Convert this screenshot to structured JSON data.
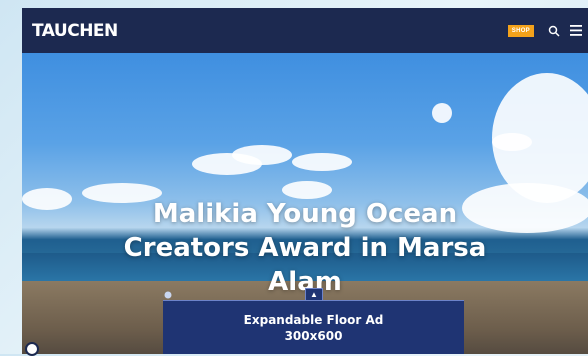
{
  "header": {
    "logo": "TAUCHEN",
    "shop_label": "SHOP",
    "search_icon": "search-icon",
    "menu_icon": "menu-icon"
  },
  "hero": {
    "headline_lines": [
      "Malikia Young Ocean",
      "Creators Award in Marsa",
      "Alam"
    ]
  },
  "ad": {
    "title": "Expandable Floor Ad",
    "size": "300x600",
    "expand_icon": "chevron-up-icon"
  },
  "colors": {
    "header_bg": "#1c2950",
    "shop_badge": "#f3a21b",
    "ad_bg": "#1f3473"
  }
}
